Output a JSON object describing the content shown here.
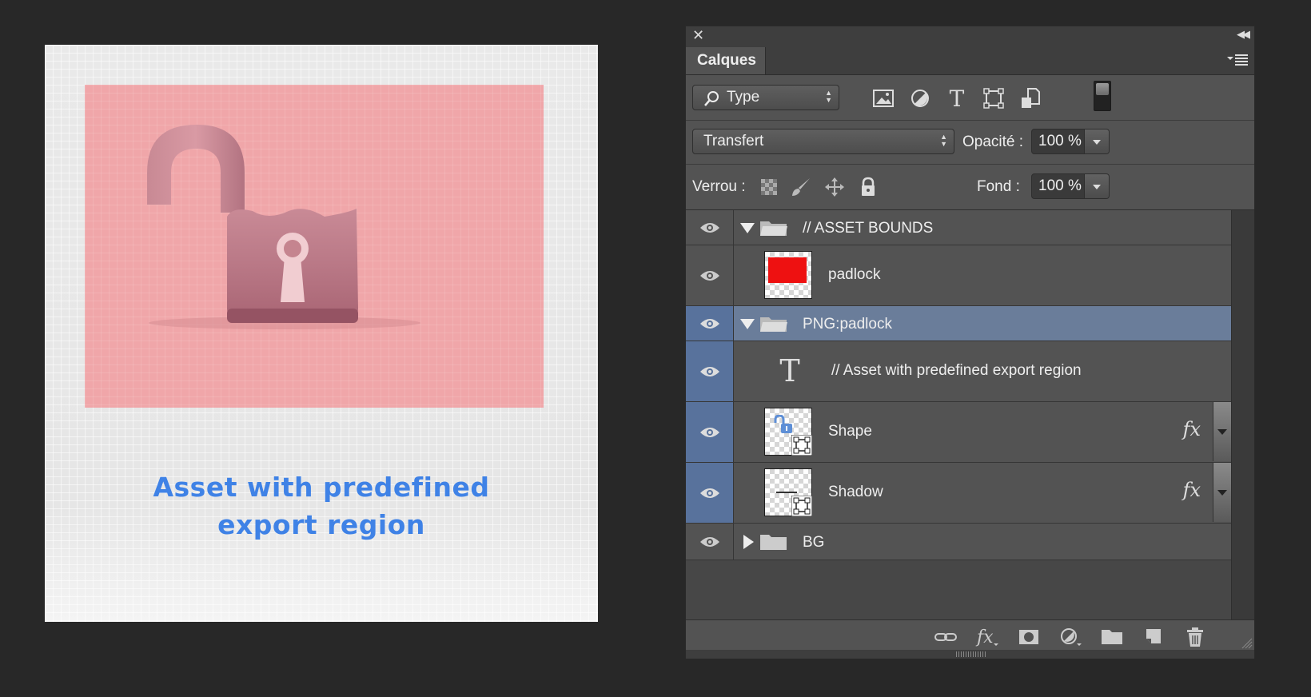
{
  "canvas": {
    "caption_line1": "Asset with predefined",
    "caption_line2": "export region",
    "bounds_color": "#f0a6a9",
    "caption_color": "#3f82e6"
  },
  "panel": {
    "tab_label": "Calques",
    "filter": {
      "label": "Type"
    },
    "filter_icons": [
      "image-filter-icon",
      "adjustment-filter-icon",
      "type-filter-icon",
      "shape-filter-icon",
      "smart-object-filter-icon"
    ],
    "blend_mode": "Transfert",
    "opacity_label": "Opacité :",
    "opacity_value": "100 %",
    "lock_label": "Verrou :",
    "fill_label": "Fond :",
    "fill_value": "100 %",
    "selection_color": "#6a7d9a"
  },
  "layers": [
    {
      "name": "// ASSET BOUNDS",
      "kind": "group",
      "expanded": true
    },
    {
      "name": "padlock",
      "kind": "pixel"
    },
    {
      "name": "PNG:padlock",
      "kind": "group",
      "expanded": true,
      "selected": true
    },
    {
      "name": "// Asset with predefined export region",
      "kind": "text"
    },
    {
      "name": "Shape",
      "kind": "shape",
      "fx": "fx"
    },
    {
      "name": "Shadow",
      "kind": "shape",
      "fx": "fx"
    },
    {
      "name": "BG",
      "kind": "group",
      "expanded": false
    }
  ]
}
